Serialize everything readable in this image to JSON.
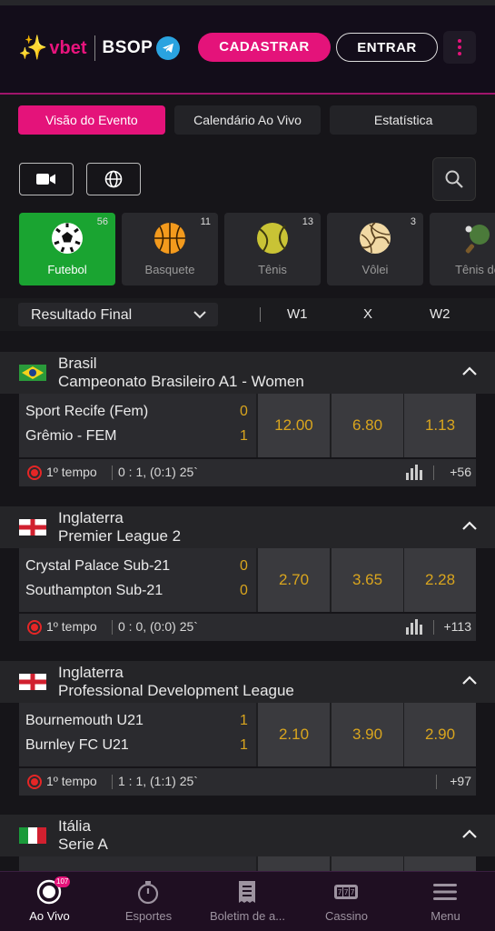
{
  "header": {
    "logo_text": "vbet",
    "partner_text": "BSOP",
    "register_label": "CADASTRAR",
    "login_label": "ENTRAR"
  },
  "tabs": [
    {
      "label": "Visão do Evento",
      "active": true
    },
    {
      "label": "Calendário Ao Vivo",
      "active": false
    },
    {
      "label": "Estatística",
      "active": false
    }
  ],
  "filters": {
    "video_icon": "video-camera-icon",
    "globe_icon": "globe-icon",
    "search_icon": "search-icon"
  },
  "sports": [
    {
      "label": "Futebol",
      "count": "56",
      "icon": "soccer-ball-icon",
      "active": true
    },
    {
      "label": "Basquete",
      "count": "11",
      "icon": "basketball-icon",
      "active": false
    },
    {
      "label": "Tênis",
      "count": "13",
      "icon": "tennis-ball-icon",
      "active": false
    },
    {
      "label": "Vôlei",
      "count": "3",
      "icon": "volleyball-icon",
      "active": false
    },
    {
      "label": "Tênis de",
      "count": "",
      "icon": "table-tennis-icon",
      "active": false
    }
  ],
  "market": {
    "selected": "Resultado Final",
    "columns": [
      "W1",
      "X",
      "W2"
    ]
  },
  "leagues": [
    {
      "country": "Brasil",
      "name": "Campeonato Brasileiro A1 - Women",
      "flag": "brazil-flag",
      "home": "Sport Recife (Fem)",
      "away": "Grêmio - FEM",
      "home_score": "0",
      "away_score": "1",
      "odds": [
        "12.00",
        "6.80",
        "1.13"
      ],
      "period": "1º tempo",
      "result": "0 : 1, (0:1) 25`",
      "more": "+56",
      "has_stats": true
    },
    {
      "country": "Inglaterra",
      "name": "Premier League 2",
      "flag": "england-flag",
      "home": "Crystal Palace Sub-21",
      "away": "Southampton Sub-21",
      "home_score": "0",
      "away_score": "0",
      "odds": [
        "2.70",
        "3.65",
        "2.28"
      ],
      "period": "1º tempo",
      "result": "0 : 0, (0:0) 25`",
      "more": "+113",
      "has_stats": true
    },
    {
      "country": "Inglaterra",
      "name": "Professional Development League",
      "flag": "england-flag",
      "home": "Bournemouth U21",
      "away": "Burnley FC U21",
      "home_score": "1",
      "away_score": "1",
      "odds": [
        "2.10",
        "3.90",
        "2.90"
      ],
      "period": "1º tempo",
      "result": "1 : 1, (1:1) 25`",
      "more": "+97",
      "has_stats": false
    },
    {
      "country": "Itália",
      "name": "Serie A",
      "flag": "italy-flag"
    }
  ],
  "bottom_nav": [
    {
      "label": "Ao Vivo",
      "icon": "live-icon",
      "badge": "107",
      "active": true
    },
    {
      "label": "Esportes",
      "icon": "stopwatch-icon",
      "active": false
    },
    {
      "label": "Boletim de a...",
      "icon": "betslip-icon",
      "active": false
    },
    {
      "label": "Cassino",
      "icon": "slot-machine-icon",
      "active": false
    },
    {
      "label": "Menu",
      "icon": "hamburger-menu-icon",
      "active": false
    }
  ],
  "colors": {
    "accent": "#e4137a",
    "active_sport": "#1aa431",
    "odds_text": "#d9a51e",
    "live": "#e52626"
  }
}
